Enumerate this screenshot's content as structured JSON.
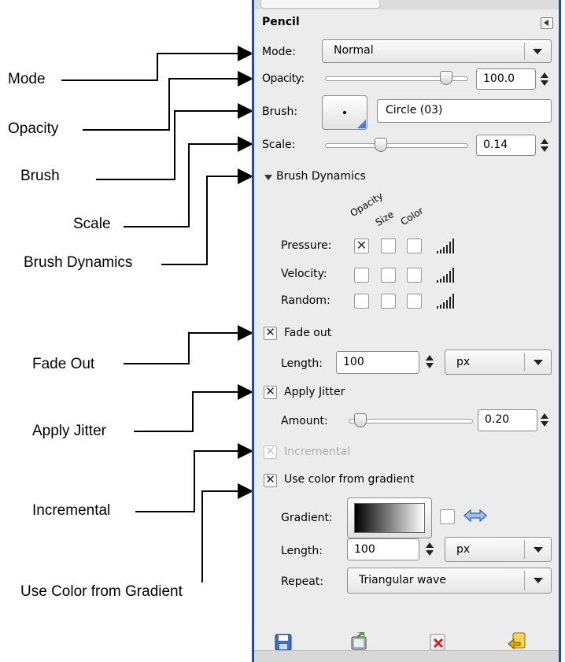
{
  "callouts": {
    "mode": "Mode",
    "opacity": "Opacity",
    "brush": "Brush",
    "scale": "Scale",
    "brush_dynamics": "Brush Dynamics",
    "fade_out": "Fade Out",
    "apply_jitter": "Apply Jitter",
    "incremental": "Incremental",
    "use_color_from_gradient": "Use Color from Gradient"
  },
  "panel": {
    "title": "Pencil",
    "mode": {
      "label": "Mode:",
      "value": "Normal"
    },
    "opacity": {
      "label": "Opacity:",
      "value": "100.0",
      "level": 0.88
    },
    "brush": {
      "label": "Brush:",
      "value": "Circle (03)"
    },
    "scale": {
      "label": "Scale:",
      "value": "0.14",
      "level": 0.38
    },
    "brush_dynamics": {
      "label": "Brush Dynamics",
      "columns": [
        "Opacity",
        "Size",
        "Color"
      ],
      "rows": [
        {
          "label": "Pressure:",
          "checked": [
            true,
            false,
            false
          ]
        },
        {
          "label": "Velocity:",
          "checked": [
            false,
            false,
            false
          ]
        },
        {
          "label": "Random:",
          "checked": [
            false,
            false,
            false
          ]
        }
      ]
    },
    "fade_out": {
      "label": "Fade out",
      "checked": true,
      "length_label": "Length:",
      "length_value": "100",
      "unit": "px"
    },
    "apply_jitter": {
      "label": "Apply Jitter",
      "checked": true,
      "amount_label": "Amount:",
      "amount_value": "0.20",
      "level": 0.05
    },
    "incremental": {
      "label": "Incremental",
      "checked": true,
      "enabled": false
    },
    "use_color_from_gradient": {
      "label": "Use color from gradient",
      "checked": true,
      "gradient_label": "Gradient:",
      "length_label": "Length:",
      "length_value": "100",
      "unit": "px",
      "repeat_label": "Repeat:",
      "repeat_value": "Triangular wave"
    },
    "footer_icons": [
      "save-icon",
      "restore-icon",
      "delete-icon",
      "reset-icon"
    ]
  },
  "colors": {
    "leader_lines": "#000000",
    "panel_border": "#1f4f9c",
    "panel_bg": "#ececec"
  }
}
